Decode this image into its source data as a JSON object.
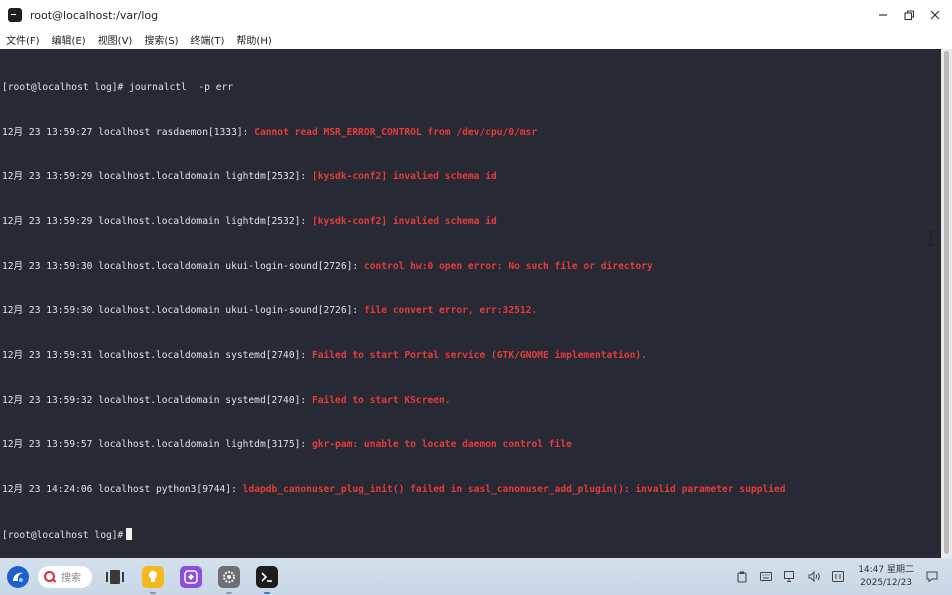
{
  "window": {
    "title": "root@localhost:/var/log"
  },
  "menu": [
    "文件(F)",
    "编辑(E)",
    "视图(V)",
    "搜索(S)",
    "终端(T)",
    "帮助(H)"
  ],
  "terminal": {
    "command_line": {
      "prompt": "[root@localhost log]#",
      "command": " journalctl  -p err"
    },
    "log_lines": [
      {
        "prefix": "12月 23 13:59:27 localhost rasdaemon[1333]: ",
        "message": "Cannot read MSR_ERROR_CONTROL from /dev/cpu/0/msr"
      },
      {
        "prefix": "12月 23 13:59:29 localhost.localdomain lightdm[2532]: ",
        "message": "[kysdk-conf2] invalied schema id"
      },
      {
        "prefix": "12月 23 13:59:29 localhost.localdomain lightdm[2532]: ",
        "message": "[kysdk-conf2] invalied schema id"
      },
      {
        "prefix": "12月 23 13:59:30 localhost.localdomain ukui-login-sound[2726]: ",
        "message": "control hw:0 open error: No such file or directory"
      },
      {
        "prefix": "12月 23 13:59:30 localhost.localdomain ukui-login-sound[2726]: ",
        "message": "file convert error, err:32512."
      },
      {
        "prefix": "12月 23 13:59:31 localhost.localdomain systemd[2740]: ",
        "message": "Failed to start Portal service (GTK/GNOME implementation)."
      },
      {
        "prefix": "12月 23 13:59:32 localhost.localdomain systemd[2740]: ",
        "message": "Failed to start KScreen."
      },
      {
        "prefix": "12月 23 13:59:57 localhost.localdomain lightdm[3175]: ",
        "message": "gkr-pam: unable to locate daemon control file"
      },
      {
        "prefix": "12月 23 14:24:06 localhost python3[9744]: ",
        "message": "ldapdb_canonuser_plug_init() failed in sasl_canonuser_add_plugin(): invalid parameter supplied"
      }
    ],
    "final_prompt": "[root@localhost log]#"
  },
  "taskbar": {
    "search_label": "搜索",
    "clock_time": "14:47 星期二",
    "clock_date": "2025/12/23"
  },
  "colors": {
    "terminal_bg": "#272a35",
    "terminal_fg": "#e3e3e3",
    "error_red": "#e53b3b"
  }
}
